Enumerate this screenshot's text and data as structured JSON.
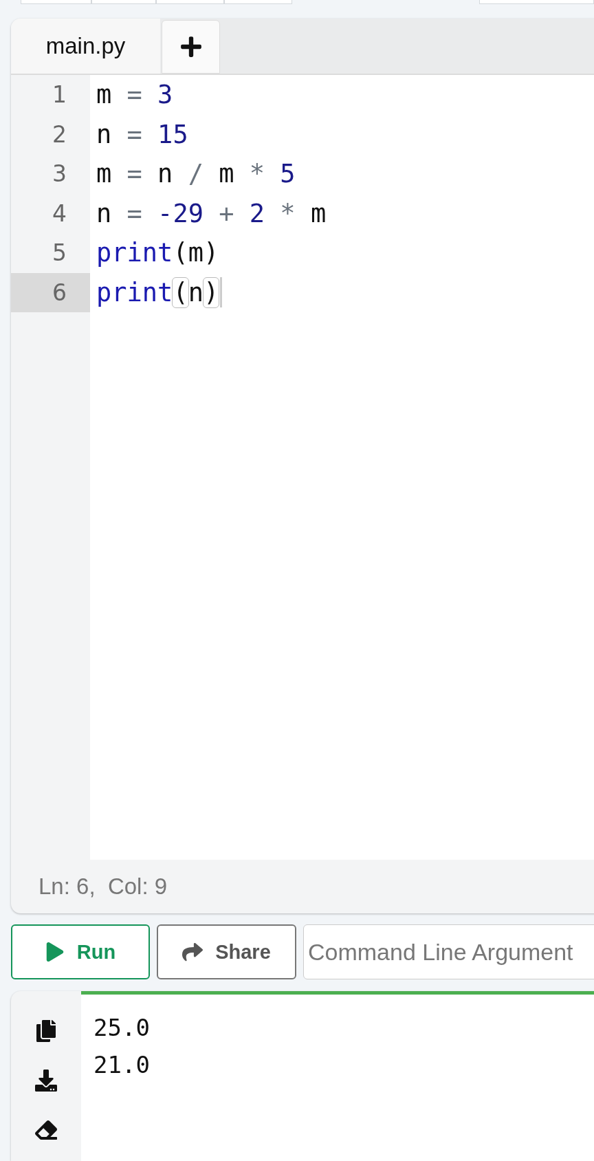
{
  "editor": {
    "tabs": [
      {
        "label": "main.py",
        "selected": true
      }
    ],
    "code_lines": [
      {
        "number": "1",
        "active": false,
        "tokens": [
          {
            "kind": "name",
            "text": "m"
          },
          {
            "kind": "op",
            "text": " = "
          },
          {
            "kind": "number",
            "text": "3"
          }
        ]
      },
      {
        "number": "2",
        "active": false,
        "tokens": [
          {
            "kind": "name",
            "text": "n"
          },
          {
            "kind": "op",
            "text": " = "
          },
          {
            "kind": "number",
            "text": "15"
          }
        ]
      },
      {
        "number": "3",
        "active": false,
        "tokens": [
          {
            "kind": "name",
            "text": "m"
          },
          {
            "kind": "op",
            "text": " = "
          },
          {
            "kind": "name",
            "text": "n"
          },
          {
            "kind": "op",
            "text": " / "
          },
          {
            "kind": "name",
            "text": "m"
          },
          {
            "kind": "op",
            "text": " * "
          },
          {
            "kind": "number",
            "text": "5"
          }
        ]
      },
      {
        "number": "4",
        "active": false,
        "tokens": [
          {
            "kind": "name",
            "text": "n"
          },
          {
            "kind": "op",
            "text": " = "
          },
          {
            "kind": "number",
            "text": "-29"
          },
          {
            "kind": "op",
            "text": " + "
          },
          {
            "kind": "number",
            "text": "2"
          },
          {
            "kind": "op",
            "text": " * "
          },
          {
            "kind": "name",
            "text": "m"
          }
        ]
      },
      {
        "number": "5",
        "active": false,
        "tokens": [
          {
            "kind": "builtin",
            "text": "print"
          },
          {
            "kind": "name",
            "text": "("
          },
          {
            "kind": "name",
            "text": "m"
          },
          {
            "kind": "name",
            "text": ")"
          }
        ]
      },
      {
        "number": "6",
        "active": true,
        "tokens": [
          {
            "kind": "builtin",
            "text": "print"
          },
          {
            "kind": "bracket",
            "text": "("
          },
          {
            "kind": "name",
            "text": "n"
          },
          {
            "kind": "bracket",
            "text": ")"
          }
        ]
      }
    ],
    "status": "Ln: 6,  Col: 9"
  },
  "buttons": [
    {
      "kind": "run",
      "label": "Run"
    },
    {
      "kind": "share",
      "label": "Share"
    }
  ],
  "arguments_field": {
    "placeholder": "Command Line Argument"
  },
  "output": {
    "lines": [
      "25.0",
      "21.0"
    ]
  }
}
